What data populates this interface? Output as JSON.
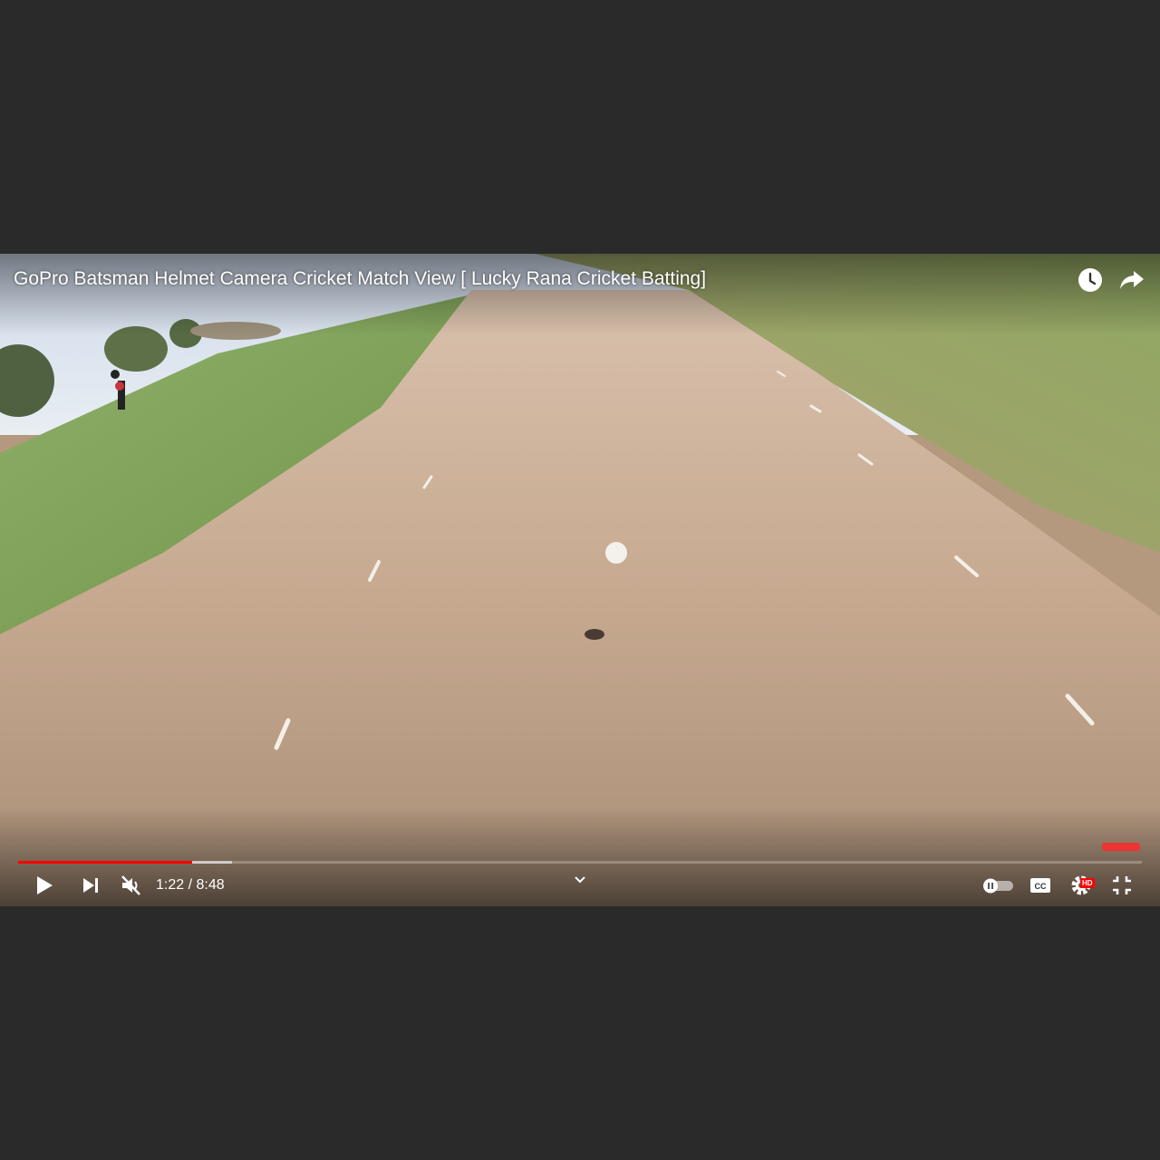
{
  "video": {
    "title": "GoPro Batsman Helmet Camera Cricket Match View [ Lucky Rana Cricket Batting]",
    "current_time": "1:22",
    "time_separator": " / ",
    "duration": "8:48",
    "progress_played_fraction": 0.155,
    "progress_buffered_fraction": 0.19,
    "muted": true,
    "quality_badge": "HD"
  },
  "top_controls": {
    "watch_later_icon": "clock-icon",
    "share_icon": "share-arrow-icon"
  },
  "bottom_controls": {
    "play_icon": "play-icon",
    "next_icon": "skip-next-icon",
    "volume_icon": "volume-muted-icon",
    "chevron_icon": "chevron-down-icon",
    "autoplay_icon": "autoplay-toggle-icon",
    "captions_icon": "cc-icon",
    "settings_icon": "gear-icon",
    "fullscreen_icon": "exit-fullscreen-icon"
  },
  "colors": {
    "progress_played": "#ff0000",
    "page_background": "#2a2a2a"
  }
}
